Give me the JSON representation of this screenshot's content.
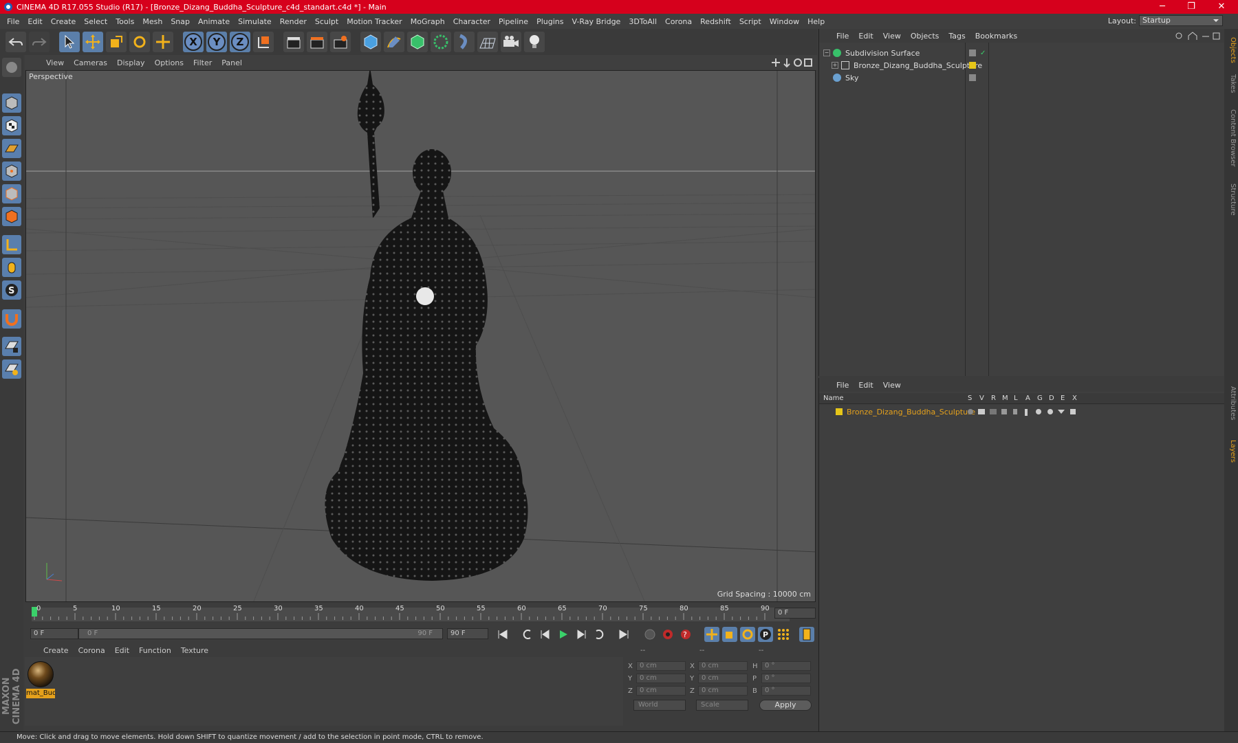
{
  "window": {
    "title": "CINEMA 4D R17.055 Studio (R17) - [Bronze_Dizang_Buddha_Sculpture_c4d_standart.c4d *] - Main",
    "minimize": "─",
    "restore": "❐",
    "close": "✕"
  },
  "menu": [
    "File",
    "Edit",
    "Create",
    "Select",
    "Tools",
    "Mesh",
    "Snap",
    "Animate",
    "Simulate",
    "Render",
    "Sculpt",
    "Motion Tracker",
    "MoGraph",
    "Character",
    "Pipeline",
    "Plugins",
    "V-Ray Bridge",
    "3DToAll",
    "Corona",
    "Redshift",
    "Script",
    "Window",
    "Help"
  ],
  "layout": {
    "label": "Layout:",
    "value": "Startup"
  },
  "toolbar": {
    "axis_x": "X",
    "axis_y": "Y",
    "axis_z": "Z"
  },
  "viewport": {
    "menu": [
      "View",
      "Cameras",
      "Display",
      "Options",
      "Filter",
      "Panel"
    ],
    "label": "Perspective",
    "grid_spacing": "Grid Spacing : 10000 cm"
  },
  "timeline": {
    "ticks": [
      "0",
      "5",
      "10",
      "15",
      "20",
      "25",
      "30",
      "35",
      "40",
      "45",
      "50",
      "55",
      "60",
      "65",
      "70",
      "75",
      "80",
      "85",
      "90"
    ],
    "current_frame": "0 F",
    "start": "0 F",
    "range_start": "0 F",
    "range_end": "90 F",
    "end": "90 F"
  },
  "materials": {
    "menu": [
      "Create",
      "Corona",
      "Edit",
      "Function",
      "Texture"
    ],
    "item": "mat_Bud"
  },
  "coords": {
    "header": [
      "--",
      "--",
      "--"
    ],
    "labels": [
      "X",
      "Y",
      "Z",
      "X",
      "Y",
      "Z",
      "H",
      "P",
      "B"
    ],
    "pos": [
      "0 cm",
      "0 cm",
      "0 cm"
    ],
    "scale": [
      "0 cm",
      "0 cm",
      "0 cm"
    ],
    "rot": [
      "0 °",
      "0 °",
      "0 °"
    ],
    "world": "World",
    "mode": "Scale",
    "apply": "Apply"
  },
  "objects": {
    "menu": [
      "File",
      "Edit",
      "View",
      "Objects",
      "Tags",
      "Bookmarks"
    ],
    "rows": [
      "Subdivision Surface",
      "Bronze_Dizang_Buddha_Sculpture",
      "Sky"
    ]
  },
  "layers": {
    "menu": [
      "File",
      "Edit",
      "View"
    ],
    "columns": [
      "Name",
      "S",
      "V",
      "R",
      "M",
      "L",
      "A",
      "G",
      "D",
      "E",
      "X"
    ],
    "rows": [
      "Bronze_Dizang_Buddha_Sculpture"
    ]
  },
  "sidetabs": [
    "Objects",
    "Takes",
    "Content Browser",
    "Structure",
    "Attributes",
    "Layers"
  ],
  "status": "Move: Click and drag to move elements. Hold down SHIFT to quantize movement / add to the selection in point mode, CTRL to remove.",
  "brand": "MAXON CINEMA 4D",
  "colors": {
    "titlebar": "#d6001c",
    "accent": "#e5a11c",
    "tool_blue": "#5b7faa",
    "layer_yellow": "#e6c619"
  }
}
